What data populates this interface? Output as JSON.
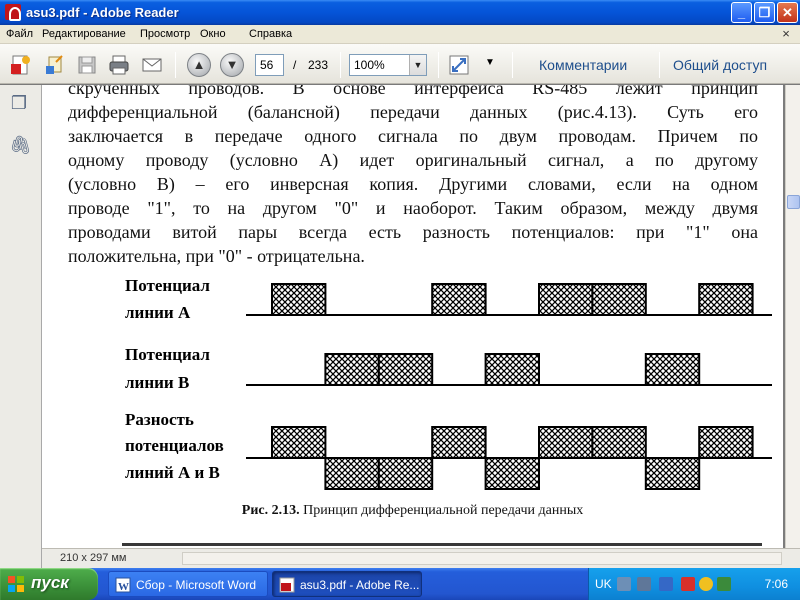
{
  "window": {
    "title": "asu3.pdf - Adobe Reader"
  },
  "menu": [
    "Файл",
    "Редактирование",
    "Просмотр",
    "Окно",
    "Справка"
  ],
  "toolbar": {
    "page_current": "56",
    "page_sep": "/",
    "page_total": "233",
    "zoom": "100%",
    "comments": "Комментарии",
    "share": "Общий доступ"
  },
  "document": {
    "paragraph_lines": [
      "скрученных проводов. В основе интерфейса RS-485 лежит принцип",
      "дифференциальной (балансной) передачи данных (рис.4.13). Суть его",
      "заключается в передаче одного сигнала по двум проводам. Причем по",
      "одному проводу (условно А) идет оригинальный сигнал, а по другому",
      "(условно В) – его инверсная копия. Другими словами, если на одном",
      "проводе \"1\", то на другом \"0\" и наоборот. Таким образом, между двумя",
      "проводами витой пары всегда есть разность потенциалов: при \"1\" она",
      "положительна, при \"0\" - отрицательна."
    ],
    "diagram": {
      "labels": {
        "a_line1": "Потенциал",
        "a_line2": "линии А",
        "b_line1": "Потенциал",
        "b_line2": "линии В",
        "d_line1": "Разность",
        "d_line2": "потенциалов",
        "d_line3": "линий А и В"
      },
      "signal_a_bits": [
        1,
        0,
        0,
        1,
        0,
        1,
        1,
        0,
        1
      ],
      "signal_b_bits": [
        0,
        1,
        1,
        0,
        1,
        0,
        0,
        1,
        0
      ]
    },
    "caption": {
      "bold": "Рис. 2.13.",
      "text": " Принцип дифференциальной передачи данных"
    }
  },
  "status": {
    "page_size": "210 x 297 мм"
  },
  "taskbar": {
    "start": "пуск",
    "tasks": [
      {
        "label": "Сбор - Microsoft Word",
        "active": false
      },
      {
        "label": "asu3.pdf - Adobe Re...",
        "active": true
      }
    ],
    "lang": "UK",
    "clock": "7:06"
  },
  "colors": {
    "titlebar": "#0554d8",
    "start_green": "#3a8f38",
    "tray_blue": "#0f8fe0",
    "link": "#1e4e8c"
  }
}
